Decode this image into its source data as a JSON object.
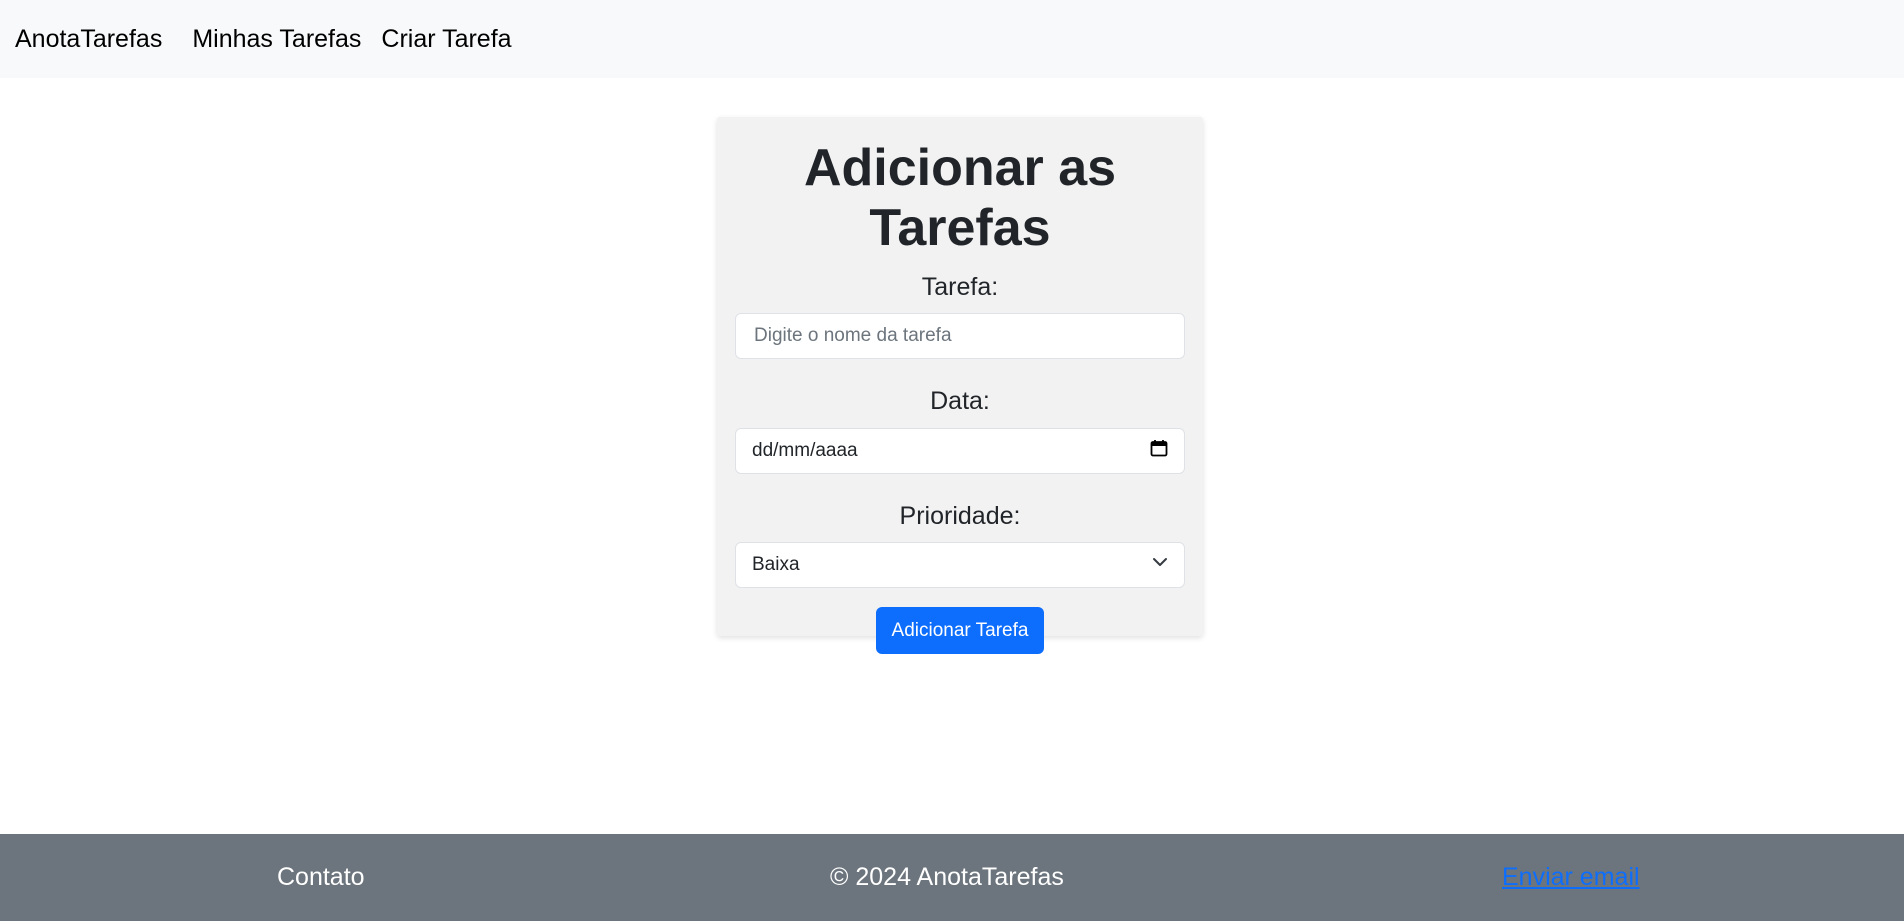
{
  "navbar": {
    "brand": "AnotaTarefas",
    "links": [
      "Minhas Tarefas",
      "Criar Tarefa"
    ]
  },
  "form": {
    "title": "Adicionar as Tarefas",
    "task_label": "Tarefa:",
    "task_placeholder": "Digite o nome da tarefa",
    "date_label": "Data:",
    "date_value": "dd/mm/aaaa",
    "priority_label": "Prioridade:",
    "priority_selected": "Baixa",
    "submit_label": "Adicionar Tarefa"
  },
  "footer": {
    "contact": "Contato",
    "copyright": "© 2024 AnotaTarefas",
    "email_link": "Enviar email"
  },
  "colors": {
    "primary": "#0d6efd",
    "navbar_bg": "#f8f9fa",
    "footer_bg": "#6c757d",
    "card_bg": "#f2f2f2"
  },
  "icons": {
    "date_picker": "calendar-icon",
    "select_arrow": "chevron-down-icon"
  }
}
